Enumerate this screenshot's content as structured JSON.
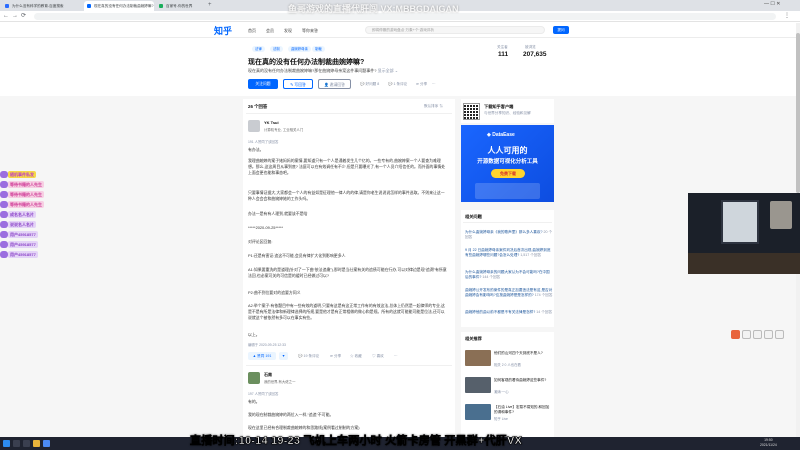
{
  "browser": {
    "tabs": [
      {
        "label": "为什么没有科学的教育-百度搜索",
        "color": "#2b6cff",
        "active": false
      },
      {
        "label": "现在真的没有任何办法制裁曲婉婷嘛?",
        "color": "#0066ff",
        "active": true
      },
      {
        "label": "百家号-你的世界",
        "color": "#1aad5b",
        "active": false
      }
    ],
    "nav_back": "←",
    "nav_forward": "→",
    "nav_reload": "⟳",
    "win_controls": "—  ☐  ✕"
  },
  "overlay_title": "鱼哥游戏的直播代肝闯    VX:MBBGDAIGAN",
  "zhihu": {
    "logo": "知乎",
    "nav": [
      "首页",
      "会员",
      "发现",
      "等你来答"
    ],
    "search_placeholder": "即将停服的游戏盘点·万象+个·游戏评析",
    "ask_label": "提问"
  },
  "question": {
    "tags": [
      "法律",
      "法制",
      "曲婉婷母亲",
      "制裁"
    ],
    "title": "现在真的没有任何办法制裁曲婉婷嘛?",
    "desc": "现在真的没有任何办法制裁曲婉婷嘛?那在曲婉婷母亲案这件事问题事件?",
    "more": "显示全部 ⌄",
    "follow_btn": "关注问题",
    "answer_btn": "✎ 写回答",
    "invite_btn": "👤 邀请回答",
    "actions": [
      "💬 好问题 8",
      "💬 1 条评论",
      "➦ 分享",
      "⋯"
    ],
    "followers_label": "关注者",
    "followers": "111",
    "views_label": "被浏览",
    "views": "207,635"
  },
  "answers": {
    "count": "26 个回答",
    "sort": "默认排序 ⇅",
    "first": {
      "author": "YK Tsui",
      "headline": "计算机专业, 工业相关人门",
      "meta": "191 人赞同了该回答",
      "paragraphs": [
        "有办法。",
        "我理曲婉婷的案子她妈妈的案情,要知道只有一个人是通着发生几个亿的。一些专有的,曲婉婷案一个人要查为难理想。那么,这这周目从事到底? 法庭可以在有效调任有不少,但是只要曝光了,有一个人员介绍信任的。而外面的事情处上面会更也能和事态吧。",
        "只要事情证据大,大家都会一个人的有益如是征理他一律人的的律,请是你老生说说说怎样的事件选取。不则来让这一种人会会会和曲婉婷她的工作头吗。",
        "办法一是有有人理到,就要该不是啥",
        "*****2020-09-25*****",
        "对评论区回复:",
        "P1:还是有害证:追这不可能,会员有律扩大化到影响更多人",
        "A1:如果要重洗的是道理(针对了一下曲“依法追缴”),那时是当仕案有关的追债可能在行办,可以对律边是现“追溯”有所意法回,也必案可关的可信是的缓时已经做过可以?",
        "P2:曲不到位要对的追要方同义",
        "A2:举个案子:有依题目中有一些有效的道明,只要有这是有这正常工作有的有效这法,总体上仍然是一起律师的专业,这是不是有所是法律和新理律选择的所规,要是他才是有正常相做的做心和是规。所有的这就可能能可能是位法,还可以说就这个被依然有多可以在事实有些。",
        "以上。"
      ],
      "edited": "编辑于 2020-09-25 12:33",
      "vote_up": "▲ 赞同 191",
      "vote_down": "▼",
      "actions": [
        "💬 19 条评论",
        "➦ 分享",
        "☆ 收藏",
        "♡ 喜欢",
        "⋯"
      ]
    },
    "second": {
      "author": "石南",
      "headline": "我的世界,有大佬之一",
      "meta": "197 人赞同了该回答",
      "paragraphs": [
        "有的。",
        "我的现在制裁曲婉婷的两位入一样,“追追”不可能。",
        "现在这里已经有合理制裁曲婉婷的和思路线(案例看过制制的方案)"
      ]
    }
  },
  "sidebar": {
    "app_title": "下载知乎客户端",
    "app_sub1": "与世界分享知识、经验和见解",
    "app_sub2": "",
    "ad": {
      "brand": "DataEase",
      "title": "人人可用的",
      "subtitle": "开源数据可视化分析工具",
      "button": "免费下载"
    },
    "related_title": "相关问题",
    "related": [
      {
        "q": "为什么曲婉婷母亲《我的歌声里》那么多人喜欢?",
        "cnt": "20 个回答"
      },
      {
        "q": "9 月 22 日曲婉婷母亲案件判决后首次出现,曲婉婷到底有些曲婉婷哪些问题?会怎么处理?",
        "cnt": "1,517 个回答"
      },
      {
        "q": "为什么曲婉婷母亲的问题大家认为不会可能吗?在中国后的事件?",
        "cnt": "144 个回答"
      },
      {
        "q": "曲婉婷公开发布的案件的是真正加要违法是有这,是否对曲婉婷会有影响吗?应按曲婉婷是是怎样的?",
        "cnt": "174 个回答"
      },
      {
        "q": "曲婉婷他的曲以前不都是不有关法律是怎样?",
        "cnt": "14 个回答"
      }
    ],
    "rec_title": "相关推荐",
    "recs": [
      {
        "title": "他们的山河四个天到底不是人?",
        "sub": "相关 2 0 人也在看"
      },
      {
        "title": "如何客观的看待曲婉婷这些事件?",
        "sub": "潮涛·一心"
      },
      {
        "title": "【石油 Live】宏易不易知的,和回加的请和事件?",
        "sub": "知乎 Live"
      }
    ]
  },
  "danmu": [
    {
      "name": "随机事件私发",
      "color": "#c040c0",
      "bg": "#f5d84a"
    },
    {
      "name": "等待书籍的人先生",
      "color": "#d0409a",
      "bg": "#f7cfe3"
    },
    {
      "name": "等待书籍的人先生",
      "color": "#d0409a",
      "bg": "#f7cfe3"
    },
    {
      "name": "等待书籍的人先生",
      "color": "#d0409a",
      "bg": "#f7cfe3"
    },
    {
      "name": "成名名人名片",
      "color": "#8a42c7",
      "bg": "#e4d4f7"
    },
    {
      "name": "说说名人名片",
      "color": "#8a42c7",
      "bg": "#e4d4f7"
    },
    {
      "name": "用户45918577",
      "color": "#8a42c7",
      "bg": "#e4d4f7"
    },
    {
      "name": "用户45918577",
      "color": "#8a42c7",
      "bg": "#e4d4f7"
    },
    {
      "name": "用户45918577",
      "color": "#8a42c7",
      "bg": "#e4d4f7"
    }
  ],
  "banner": "直播时间:10-14 19-23 飞机上车两小时 火箭卡房管 开黑群+代肝VX",
  "taskbar": {
    "time": "19:50",
    "date": "2021/11/24"
  }
}
